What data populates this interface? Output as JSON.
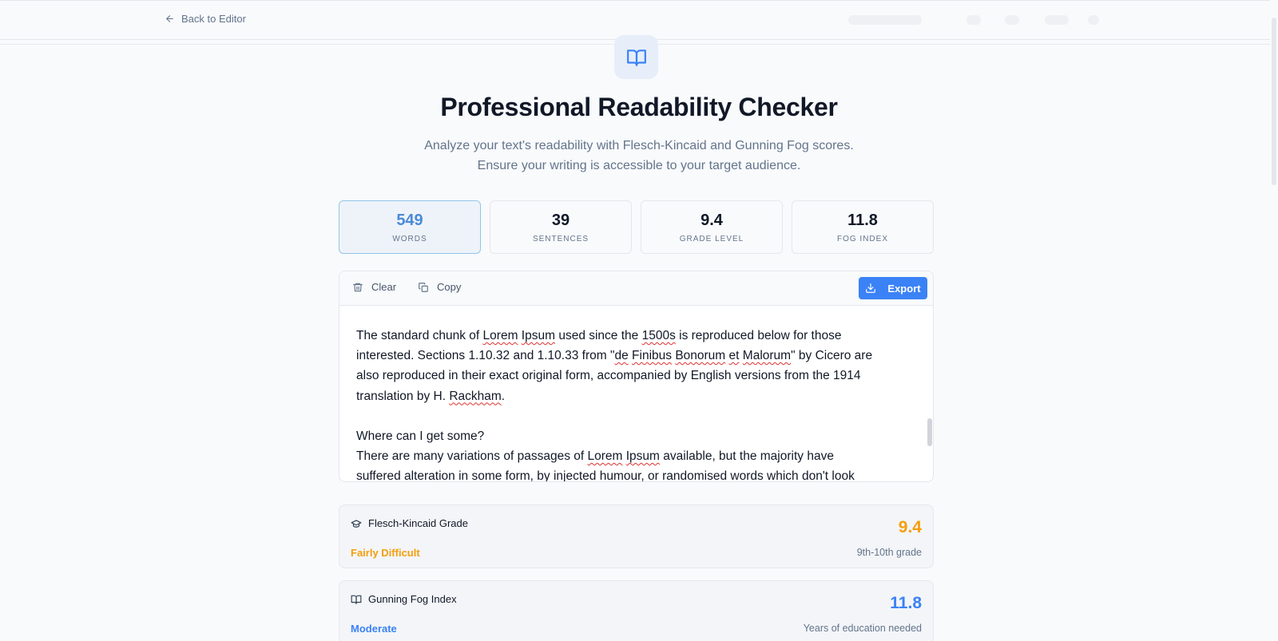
{
  "nav": {
    "back_label": "Back to Editor"
  },
  "hero": {
    "icon": "book-open-icon",
    "title": "Professional Readability Checker",
    "subtitle_line1": "Analyze your text's readability with Flesch-Kincaid and Gunning Fog scores.",
    "subtitle_line2": "Ensure your writing is accessible to your target audience."
  },
  "stats": [
    {
      "value": "549",
      "label": "WORDS"
    },
    {
      "value": "39",
      "label": "SENTENCES"
    },
    {
      "value": "9.4",
      "label": "GRADE LEVEL"
    },
    {
      "value": "11.8",
      "label": "FOG INDEX"
    }
  ],
  "toolbar": {
    "clear_label": "Clear",
    "copy_label": "Copy",
    "export_label": "Export"
  },
  "editor": {
    "text": [
      "The standard chunk of Lorem Ipsum used since the 1500s is reproduced below for those",
      "interested. Sections 1.10.32 and 1.10.33 from \"de Finibus Bonorum et Malorum\" by Cicero are",
      "also reproduced in their exact original form, accompanied by English versions from the 1914",
      "translation by H. Rackham.",
      "",
      "Where can I get some?",
      "There are many variations of passages of Lorem Ipsum available, but the majority have",
      "suffered alteration in some form, by injected humour, or randomised words which don't look"
    ]
  },
  "results": {
    "flesch": {
      "title": "Flesch-Kincaid Grade",
      "score": "9.4",
      "level": "Fairly Difficult",
      "description": "9th-10th grade",
      "color": "#f59e0b"
    },
    "fog": {
      "title": "Gunning Fog Index",
      "score": "11.8",
      "level": "Moderate",
      "description": "Years of education needed",
      "color": "#3b82f6"
    }
  }
}
